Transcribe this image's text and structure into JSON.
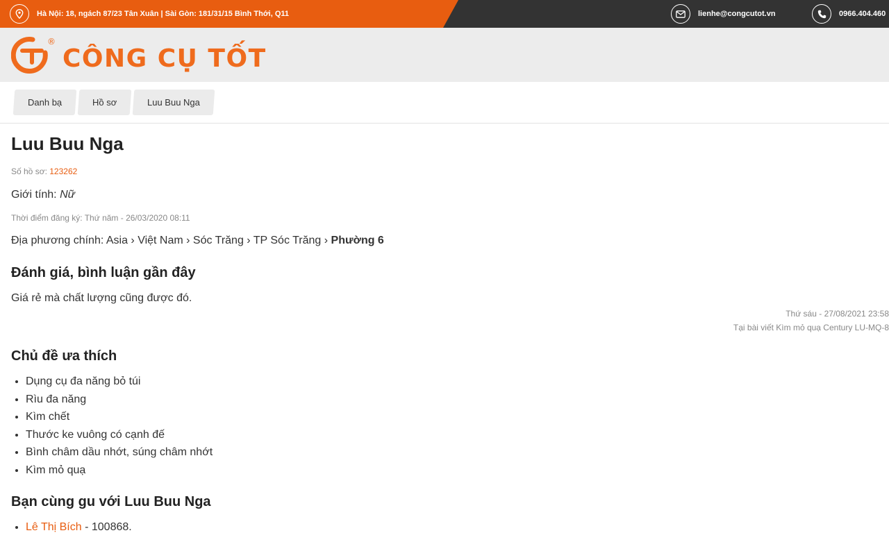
{
  "topbar": {
    "address": "Hà Nội: 18, ngách 87/23 Tân Xuân | Sài Gòn: 181/31/15 Bình Thới, Q11",
    "email": "lienhe@congcutot.vn",
    "phone": "0966.404.460",
    "accent_color": "#e85d10"
  },
  "header": {
    "logo_text": "CÔNG CỤ TỐT",
    "logo_registered": "®"
  },
  "breadcrumb": [
    "Danh bạ",
    "Hồ sơ",
    "Luu Buu Nga"
  ],
  "profile": {
    "name": "Luu Buu Nga",
    "profile_no_label": "Số hồ sơ:",
    "profile_no": "123262",
    "gender_label": "Giới tính:",
    "gender": "Nữ",
    "registered_at": "Thời điểm đăng ký: Thứ năm - 26/03/2020 08:11",
    "location_label": "Địa phương chính:",
    "location_path": "Asia › Việt Nam › Sóc Trăng › TP Sóc Trăng ›",
    "location_last": "Phường 6"
  },
  "reviews": {
    "heading": "Đánh giá, bình luận gần đây",
    "text": "Giá rẻ mà chất lượng cũng được đó.",
    "date": "Thứ sáu - 27/08/2021 23:58",
    "post": "Tại bài viết Kìm mỏ quạ Century LU-MQ-8"
  },
  "topics": {
    "heading": "Chủ đề ưa thích",
    "items": [
      "Dụng cụ đa năng bỏ túi",
      "Rìu đa năng",
      "Kìm chết",
      "Thước ke vuông có cạnh đế",
      "Bình châm dầu nhớt, súng châm nhớt",
      "Kìm mỏ quạ"
    ]
  },
  "friends": {
    "heading": "Bạn cùng gu với Luu Buu Nga",
    "items": [
      {
        "name": "Lê Thị Bích",
        "id": "- 100868."
      }
    ]
  }
}
